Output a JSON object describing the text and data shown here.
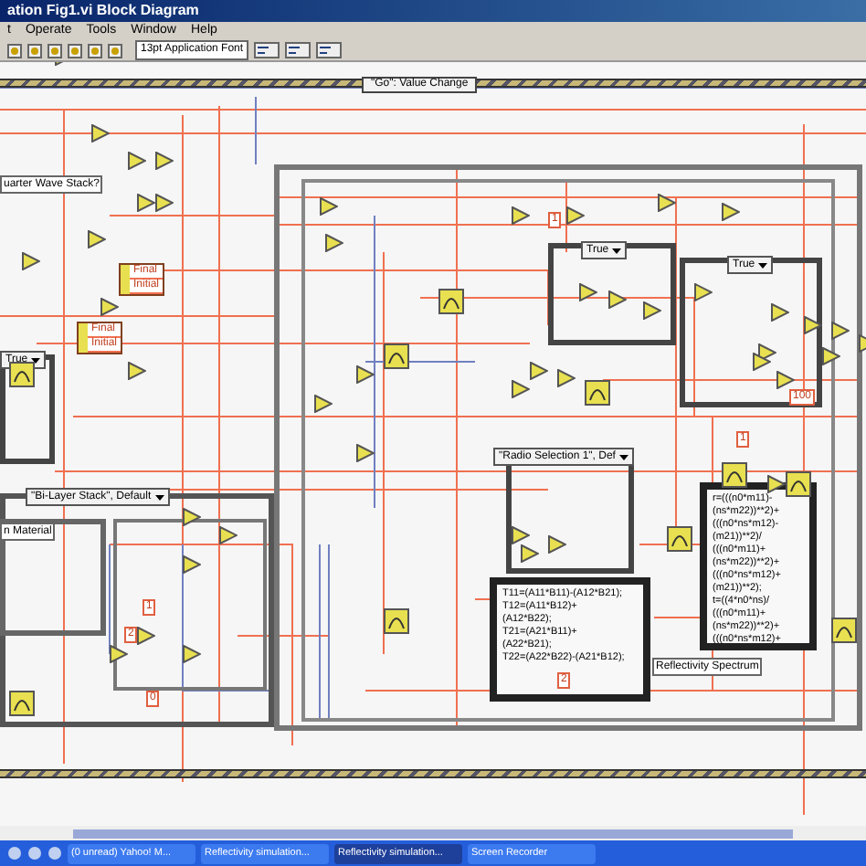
{
  "window": {
    "title": "ation Fig1.vi Block Diagram"
  },
  "menu": [
    "t",
    "Operate",
    "Tools",
    "Window",
    "Help"
  ],
  "toolbar": {
    "font": "13pt Application Font"
  },
  "diagram": {
    "event_selector": "\"Go\": Value Change",
    "labels": [
      "uarter Wave Stack?",
      "n Material",
      "Reflectivity Spectrum"
    ],
    "case_selectors": [
      {
        "text": "True"
      },
      {
        "text": "True"
      },
      {
        "text": "True"
      },
      {
        "text": "\"Radio Selection 1\", Def"
      },
      {
        "text": "\"Bi-Layer Stack\", Default"
      }
    ],
    "bundle_nodes": [
      {
        "fields": [
          "Final",
          "Initial"
        ]
      },
      {
        "fields": [
          "Final",
          "Initial"
        ]
      }
    ],
    "formula_nodes": [
      {
        "lines": [
          "T11=(A11*B11)-(A12*B21);",
          "T12=(A11*B12)+",
          "(A12*B22);",
          "T21=(A21*B11)+",
          "(A22*B21);",
          "T22=(A22*B22)-(A21*B12);"
        ]
      },
      {
        "lines": [
          "r=(((n0*m11)-",
          "(ns*m22))**2)+",
          "(((n0*ns*m12)-",
          "(m21))**2)/",
          "(((n0*m11)+",
          "(ns*m22))**2)+",
          "(((n0*ns*m12)+",
          "(m21))**2);",
          "t=((4*n0*ns)/",
          "(((n0*m11)+",
          "(ns*m22))**2)+",
          "(((n0*ns*m12)+"
        ]
      }
    ],
    "constants": [
      {
        "text": "1"
      },
      {
        "text": "2"
      },
      {
        "text": "100"
      },
      {
        "text": "1"
      },
      {
        "text": "0"
      },
      {
        "text": "2"
      },
      {
        "text": "1"
      }
    ]
  },
  "taskbar": {
    "items": [
      {
        "label": "(0 unread) Yahoo! M...",
        "selected": false
      },
      {
        "label": "Reflectivity simulation...",
        "selected": false
      },
      {
        "label": "Reflectivity simulation...",
        "selected": true
      },
      {
        "label": "Screen Recorder",
        "selected": false
      }
    ]
  }
}
